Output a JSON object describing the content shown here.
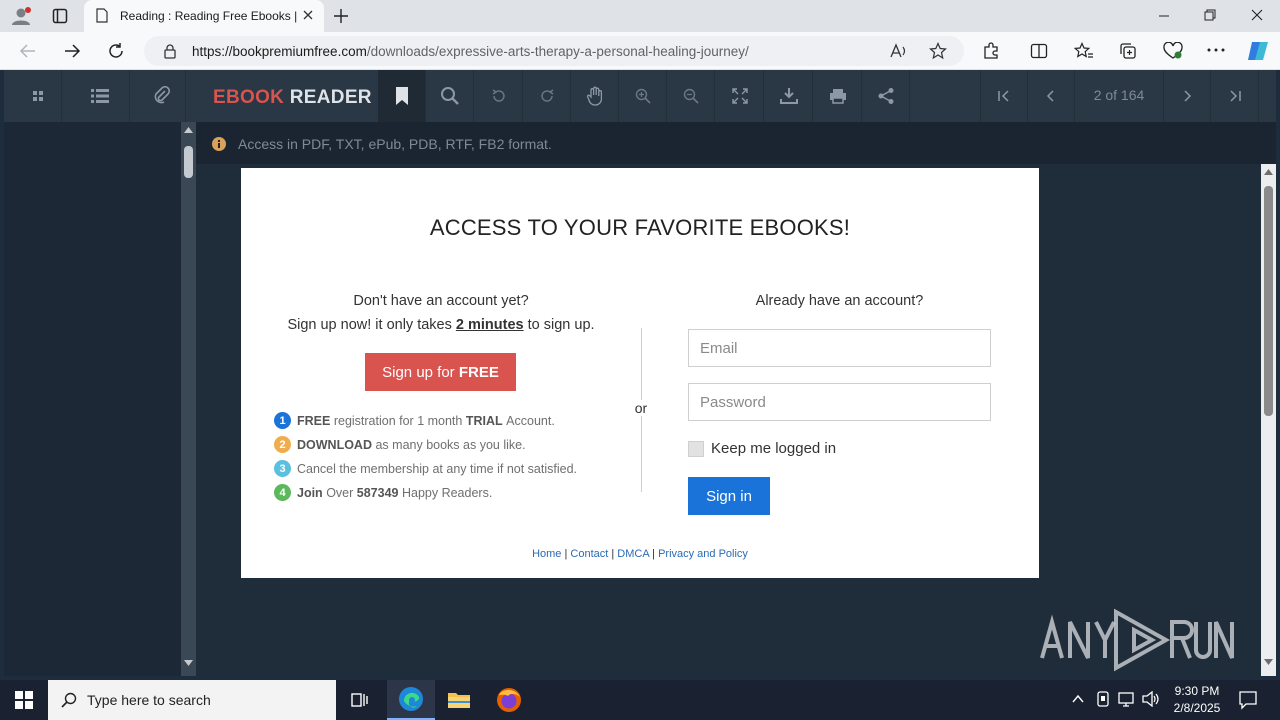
{
  "browser": {
    "tab_title": "Reading : Reading Free Ebooks | F",
    "url_host": "https://bookpremiumfree.com",
    "url_path": "/downloads/expressive-arts-therapy-a-personal-healing-journey/"
  },
  "reader": {
    "logo_part1": "EBOOK",
    "logo_part2": "READER",
    "page_counter": "2 of 164",
    "notice": "Access in PDF, TXT, ePub, PDB, RTF, FB2 format."
  },
  "card": {
    "title": "ACCESS TO YOUR FAVORITE EBOOKS!",
    "no_account": "Don't have an account yet?",
    "signup_pre": "Sign up now! it only takes",
    "signup_bold": "2 minutes",
    "signup_post": "to sign up.",
    "signup_btn_pre": "Sign up for",
    "signup_btn_bold": "FREE",
    "steps": [
      {
        "num": "1",
        "color": "#1a73d9",
        "bold1": "FREE",
        "text1": "registration for 1 month",
        "bold2": "TRIAL",
        "text2": "Account."
      },
      {
        "num": "2",
        "color": "#f0ad4e",
        "bold1": "DOWNLOAD",
        "text1": "as many books as you like.",
        "bold2": "",
        "text2": ""
      },
      {
        "num": "3",
        "color": "#5bc0de",
        "bold1": "",
        "text1": "Cancel the membership at any time if not satisfied.",
        "bold2": "",
        "text2": ""
      },
      {
        "num": "4",
        "color": "#5cb85c",
        "bold1": "Join",
        "text1": "Over",
        "bold2": "587349",
        "text2": "Happy Readers."
      }
    ],
    "or": "or",
    "have_account": "Already have an account?",
    "email_placeholder": "Email",
    "password_placeholder": "Password",
    "keep_logged": "Keep me logged in",
    "signin_btn": "Sign in",
    "footer": {
      "home": "Home",
      "contact": "Contact",
      "dmca": "DMCA",
      "privacy": "Privacy and Policy"
    }
  },
  "taskbar": {
    "search_placeholder": "Type here to search",
    "time": "9:30 PM",
    "date": "2/8/2025"
  },
  "watermark": "ANY RUN"
}
